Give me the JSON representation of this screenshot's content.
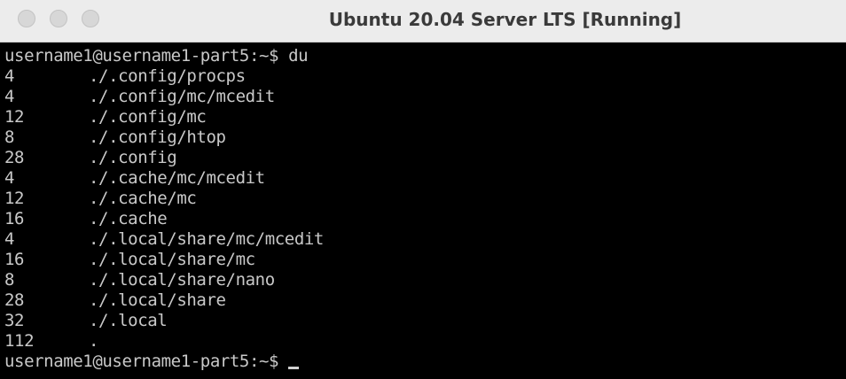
{
  "window": {
    "title": "Ubuntu 20.04 Server LTS [Running]"
  },
  "terminal": {
    "prompt": "username1@username1-part5:~$ du",
    "rows": [
      {
        "size": "4",
        "path": "./.config/procps"
      },
      {
        "size": "4",
        "path": "./.config/mc/mcedit"
      },
      {
        "size": "12",
        "path": "./.config/mc"
      },
      {
        "size": "8",
        "path": "./.config/htop"
      },
      {
        "size": "28",
        "path": "./.config"
      },
      {
        "size": "4",
        "path": "./.cache/mc/mcedit"
      },
      {
        "size": "12",
        "path": "./.cache/mc"
      },
      {
        "size": "16",
        "path": "./.cache"
      },
      {
        "size": "4",
        "path": "./.local/share/mc/mcedit"
      },
      {
        "size": "16",
        "path": "./.local/share/mc"
      },
      {
        "size": "8",
        "path": "./.local/share/nano"
      },
      {
        "size": "28",
        "path": "./.local/share"
      },
      {
        "size": "32",
        "path": "./.local"
      },
      {
        "size": "112",
        "path": "."
      }
    ],
    "final_prompt": "username1@username1-part5:~$ "
  }
}
